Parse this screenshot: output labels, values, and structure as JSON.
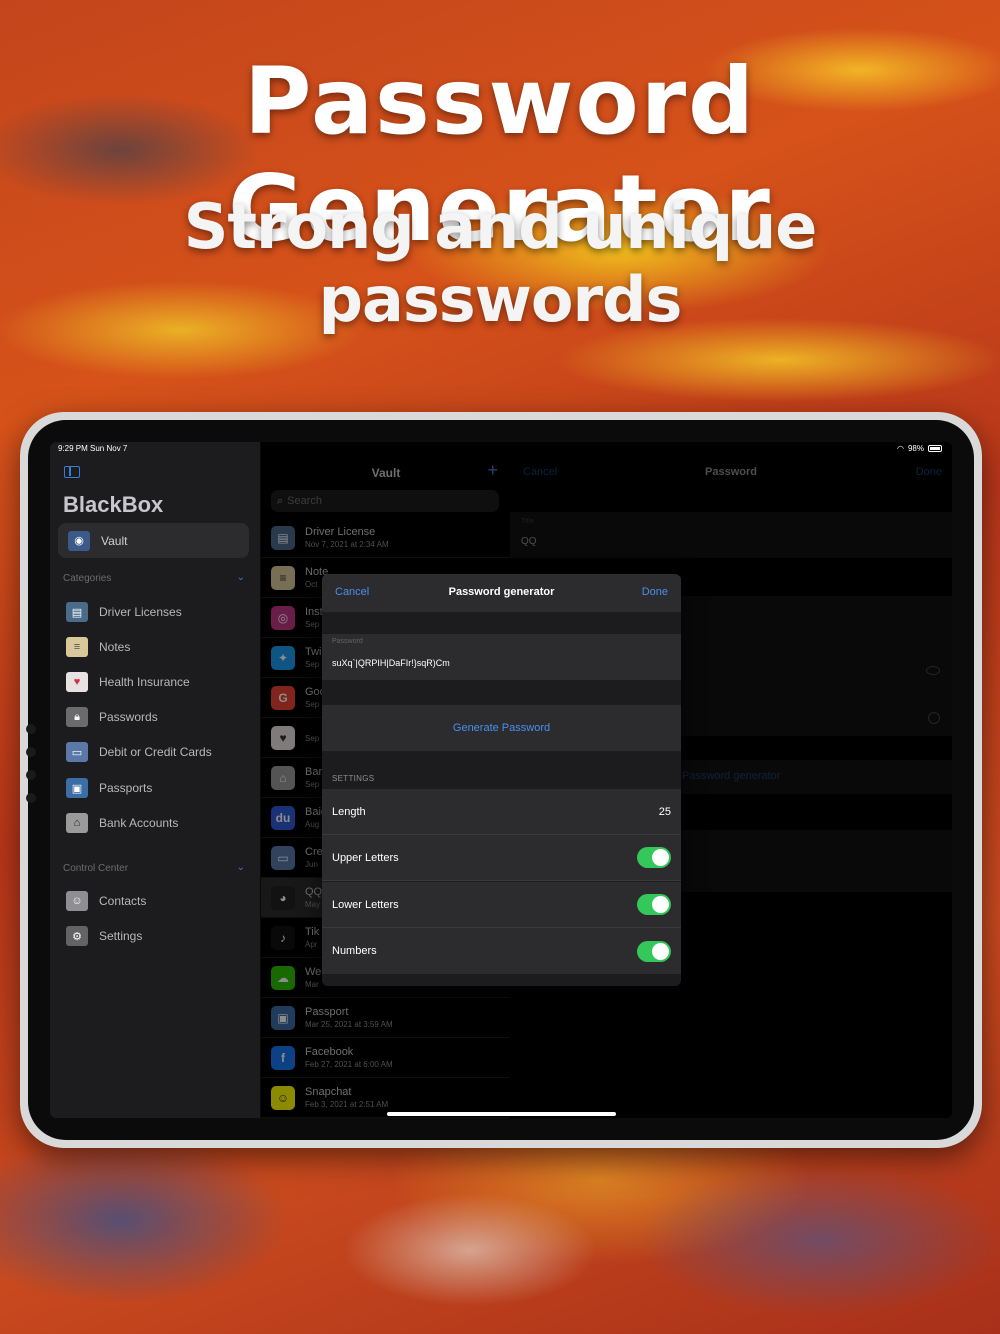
{
  "hero": {
    "title": "Password Generator",
    "subtitle": "Strong and unique passwords"
  },
  "status": {
    "time": "9:29 PM  Sun Nov 7",
    "battery": "98%"
  },
  "sidebar": {
    "app_name": "BlackBox",
    "vault_label": "Vault",
    "categories_label": "Categories",
    "categories": [
      {
        "label": "Driver Licenses",
        "icon": "id-card-icon",
        "color": "#4a6b8a"
      },
      {
        "label": "Notes",
        "icon": "note-icon",
        "color": "#d9c89a"
      },
      {
        "label": "Health Insurance",
        "icon": "heart-icon",
        "color": "#e8e1e1"
      },
      {
        "label": "Passwords",
        "icon": "lock-icon",
        "color": "#6b6b6b"
      },
      {
        "label": "Debit or Credit Cards",
        "icon": "credit-card-icon",
        "color": "#5a78a8"
      },
      {
        "label": "Passports",
        "icon": "passport-icon",
        "color": "#3b6ea5"
      },
      {
        "label": "Bank Accounts",
        "icon": "bank-icon",
        "color": "#9a9a9a"
      }
    ],
    "control_center_label": "Control Center",
    "control_center": [
      {
        "label": "Contacts",
        "icon": "contacts-icon",
        "color": "#8e8e93"
      },
      {
        "label": "Settings",
        "icon": "gear-icon",
        "color": "#636366"
      }
    ]
  },
  "list": {
    "title": "Vault",
    "search_placeholder": "Search",
    "items": [
      {
        "title": "Driver License",
        "date": "Nov 7, 2021 at 2:34 AM",
        "icon": "id-card-icon",
        "glyph": "▤",
        "color": "#4a6b8a"
      },
      {
        "title": "Note",
        "date": "Oct",
        "icon": "note-icon",
        "glyph": "≡",
        "color": "#d9c89a"
      },
      {
        "title": "Inst",
        "date": "Sep",
        "icon": "instagram-icon",
        "glyph": "◎",
        "color": "#c13584"
      },
      {
        "title": "Twi",
        "date": "Sep",
        "icon": "twitter-icon",
        "glyph": "✦",
        "color": "#1d9bf0"
      },
      {
        "title": "Goo",
        "date": "Sep",
        "icon": "google-icon",
        "glyph": "G",
        "color": "#ea4335"
      },
      {
        "title": "",
        "date": "Sep",
        "icon": "heart-icon",
        "glyph": "♥",
        "color": "#e8e1e1"
      },
      {
        "title": "Bar",
        "date": "Sep",
        "icon": "bank-icon",
        "glyph": "⌂",
        "color": "#9a9a9a"
      },
      {
        "title": "Baid",
        "date": "Aug 2",
        "icon": "baidu-icon",
        "glyph": "du",
        "color": "#2f5bd9"
      },
      {
        "title": "Cre",
        "date": "Jun",
        "icon": "credit-card-icon",
        "glyph": "▭",
        "color": "#5a78a8"
      },
      {
        "title": "QQ",
        "date": "May 2",
        "icon": "qq-icon",
        "glyph": "◕",
        "color": "#222"
      },
      {
        "title": "Tik",
        "date": "Apr",
        "icon": "tiktok-icon",
        "glyph": "♪",
        "color": "#111"
      },
      {
        "title": "We",
        "date": "Mar",
        "icon": "wechat-icon",
        "glyph": "☁",
        "color": "#2dc100"
      },
      {
        "title": "Passport",
        "date": "Mar 25, 2021 at 3:59 AM",
        "icon": "passport-icon",
        "glyph": "▣",
        "color": "#3b6ea5"
      },
      {
        "title": "Facebook",
        "date": "Feb 27, 2021 at 6:00 AM",
        "icon": "facebook-icon",
        "glyph": "f",
        "color": "#1877f2"
      },
      {
        "title": "Snapchat",
        "date": "Feb 3, 2021 at 2:51 AM",
        "icon": "snapchat-icon",
        "glyph": "☺",
        "color": "#fffc00"
      }
    ]
  },
  "detail": {
    "cancel": "Cancel",
    "title": "Password",
    "done": "Done",
    "title_label": "Title",
    "title_value": "QQ",
    "generator_link": "Password generator"
  },
  "modal": {
    "cancel": "Cancel",
    "title": "Password generator",
    "done": "Done",
    "password_label": "Password",
    "password_value": "suXq`|QRPIH|DaFIr!}sqR)Cm",
    "generate_label": "Generate Password",
    "settings_header": "SETTINGS",
    "rows": [
      {
        "label": "Length",
        "value": "25"
      },
      {
        "label": "Upper Letters",
        "enabled": true
      },
      {
        "label": "Lower Letters",
        "enabled": true
      },
      {
        "label": "Numbers",
        "enabled": true
      }
    ],
    "toggle_on_color": "#34c759",
    "accent": "#4a8ef0"
  }
}
